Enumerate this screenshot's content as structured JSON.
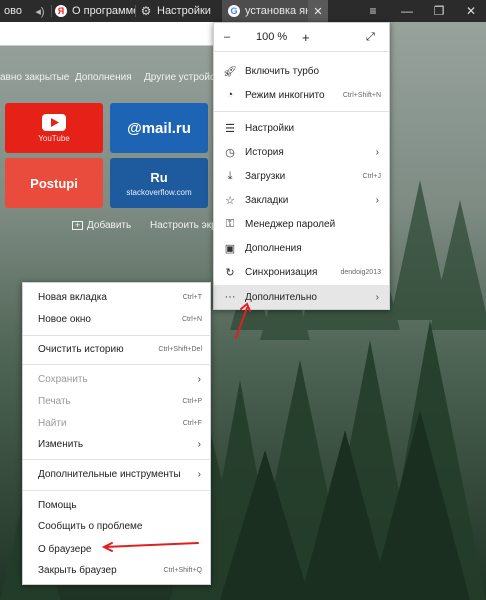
{
  "tabs": [
    {
      "label": "ово"
    },
    {
      "label": "О программе"
    },
    {
      "label": "Настройки"
    },
    {
      "label": "установка янд"
    }
  ],
  "window_controls": {
    "menu": "≡",
    "minimize": "—",
    "restore": "❐",
    "close": "✕"
  },
  "new_tab_page": {
    "links": [
      "авно закрытые",
      "Дополнения",
      "Другие устройст"
    ],
    "tiles": [
      {
        "title": "",
        "subtitle": "YouTube",
        "color": "#e62117"
      },
      {
        "title": "@mail.ru",
        "subtitle": "",
        "color": "#1e64b4"
      },
      {
        "title": "Postupi",
        "subtitle": "",
        "color": "#e94b3c"
      },
      {
        "title": "Ru",
        "subtitle": "stackoverflow.com",
        "color": "#1d5a9e"
      }
    ],
    "add_label": "Добавить",
    "customize_label": "Настроить экра"
  },
  "main_menu": {
    "zoom": {
      "minus": "–",
      "value": "100 %",
      "plus": "+"
    },
    "items": [
      {
        "icon": "rocket-icon",
        "label": "Включить турбо",
        "hint": ""
      },
      {
        "icon": "incognito-icon",
        "label": "Режим инкогнито",
        "hint": "Ctrl+Shift+N"
      },
      {
        "icon": "settings-icon",
        "label": "Настройки",
        "hint": "",
        "arrow": false
      },
      {
        "icon": "history-icon",
        "label": "История",
        "hint": "",
        "arrow": true
      },
      {
        "icon": "download-icon",
        "label": "Загрузки",
        "hint": "Ctrl+J"
      },
      {
        "icon": "bookmark-icon",
        "label": "Закладки",
        "hint": "",
        "arrow": true
      },
      {
        "icon": "key-icon",
        "label": "Менеджер паролей",
        "hint": ""
      },
      {
        "icon": "extensions-icon",
        "label": "Дополнения",
        "hint": ""
      },
      {
        "icon": "sync-icon",
        "label": "Синхронизация",
        "hint": "dendoig2013"
      },
      {
        "icon": "more-icon",
        "label": "Дополнительно",
        "hint": "",
        "arrow": true
      }
    ]
  },
  "sub_menu": {
    "items": [
      {
        "label": "Новая вкладка",
        "hint": "Ctrl+T"
      },
      {
        "label": "Новое окно",
        "hint": "Ctrl+N"
      },
      {
        "label": "Очистить историю",
        "hint": "Ctrl+Shift+Del"
      },
      {
        "label": "Сохранить",
        "hint": "",
        "arrow": true
      },
      {
        "label": "Печать",
        "hint": "Ctrl+P"
      },
      {
        "label": "Найти",
        "hint": "Ctrl+F"
      },
      {
        "label": "Изменить",
        "hint": "",
        "arrow": true
      },
      {
        "label": "Дополнительные инструменты",
        "hint": "",
        "arrow": true
      },
      {
        "label": "Помощь",
        "hint": ""
      },
      {
        "label": "Сообщить о проблеме",
        "hint": ""
      },
      {
        "label": "О браузере",
        "hint": ""
      },
      {
        "label": "Закрыть браузер",
        "hint": "Ctrl+Shift+Q"
      }
    ]
  },
  "colors": {
    "annotation_arrow": "#e02020",
    "tab_bar": "#2b2b2b",
    "menu_highlight": "#e6e6e6"
  }
}
